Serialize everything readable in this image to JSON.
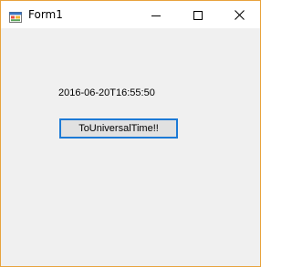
{
  "window": {
    "title": "Form1",
    "icon": "winforms-app-icon",
    "controls": {
      "minimize": "minimize-icon",
      "maximize": "maximize-icon",
      "close": "close-icon"
    }
  },
  "form": {
    "date_label": "2016-06-20T16:55:50",
    "button_label": "ToUniversalTime!!"
  },
  "colors": {
    "window_border": "#e8a33d",
    "client_background": "#f0f0f0",
    "button_focus_border": "#1c7ad6",
    "button_background": "#e1e1e1"
  }
}
